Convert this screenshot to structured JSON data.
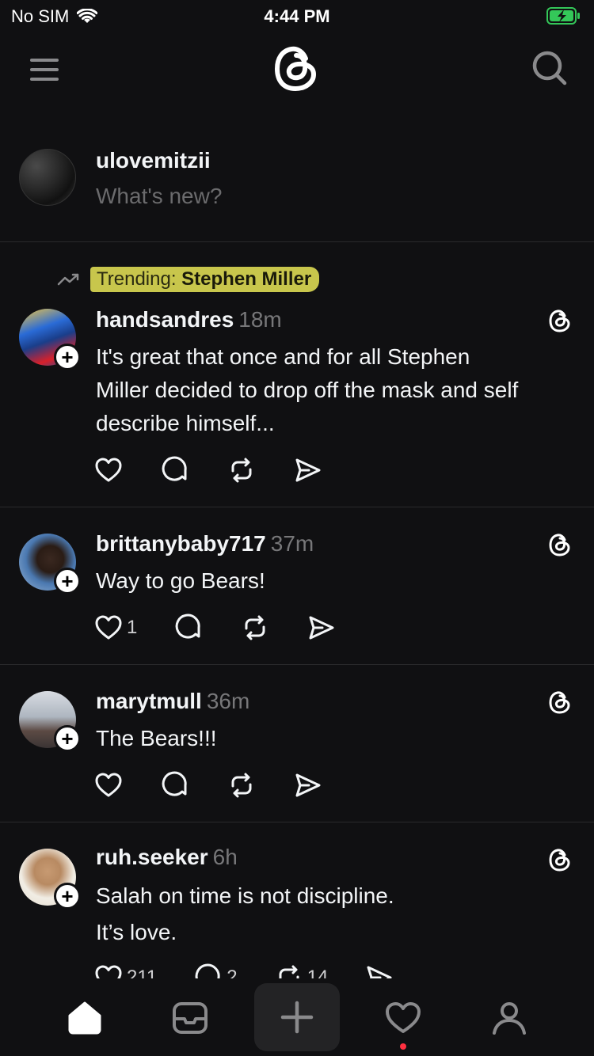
{
  "status": {
    "carrier": "No SIM",
    "time": "4:44 PM"
  },
  "composer": {
    "username": "ulovemitzii",
    "placeholder": "What's new?"
  },
  "trending": {
    "label": "Trending:",
    "topic": "Stephen Miller"
  },
  "posts": [
    {
      "username": "handsandres",
      "time": "18m",
      "lines": [
        "It's great that once and for all Stephen",
        "Miller decided to drop off the mask and self",
        "describe himself..."
      ],
      "likes": "",
      "replies": "",
      "reposts": ""
    },
    {
      "username": "brittanybaby717",
      "time": "37m",
      "lines": [
        "Way to go Bears!"
      ],
      "likes": "1",
      "replies": "",
      "reposts": ""
    },
    {
      "username": "marytmull",
      "time": "36m",
      "lines": [
        "The Bears!!!"
      ],
      "likes": "",
      "replies": "",
      "reposts": ""
    },
    {
      "username": "ruh.seeker",
      "time": "6h",
      "lines": [
        "Salah on time is not discipline.",
        "It’s love."
      ],
      "likes": "211",
      "replies": "2",
      "reposts": "14"
    }
  ],
  "icons": {
    "menu": "menu-icon",
    "logo": "threads-logo-icon",
    "search": "search-icon",
    "home": "home-icon",
    "inbox": "inbox-icon",
    "create": "plus-icon",
    "activity": "heart-icon",
    "profile": "profile-icon"
  },
  "colors": {
    "background": "#101012",
    "highlight": "#e9e657",
    "notification": "#ff3040",
    "battery": "#34c759"
  }
}
